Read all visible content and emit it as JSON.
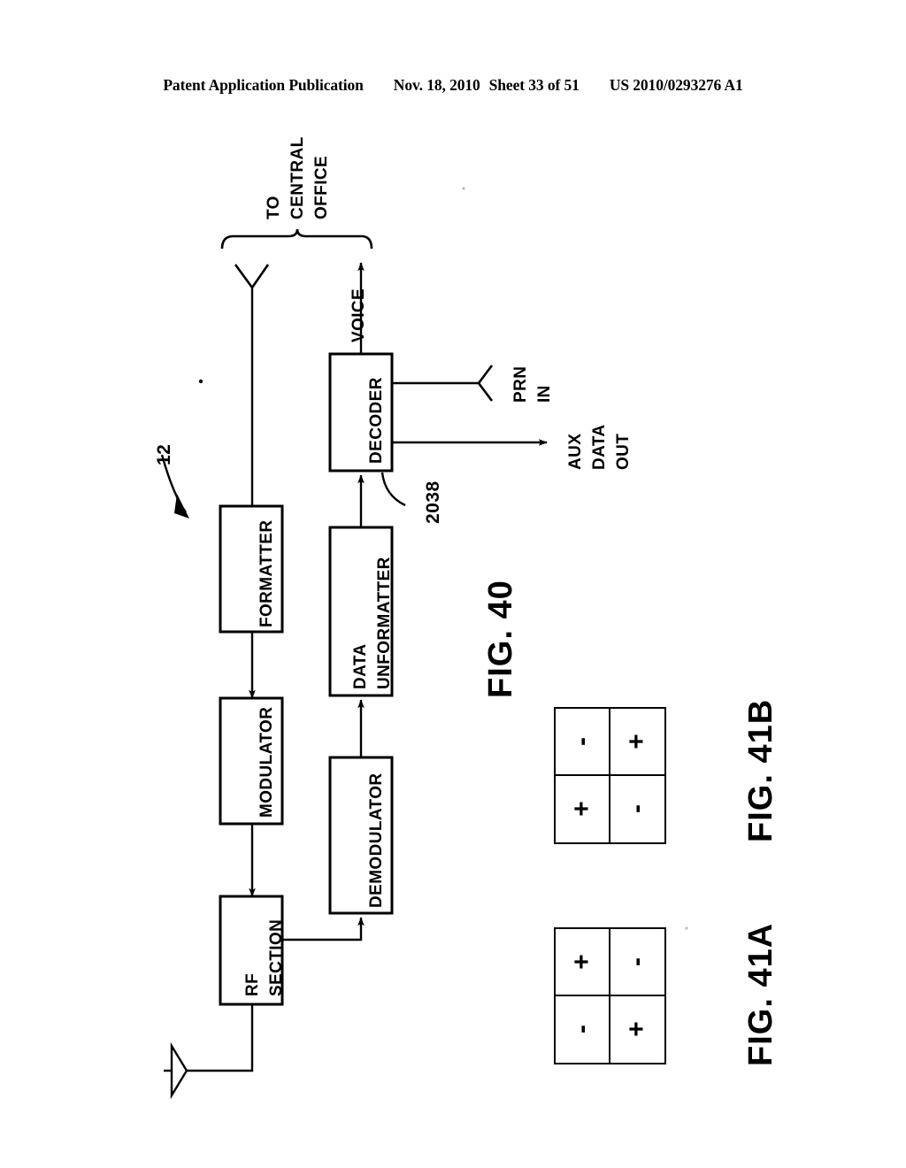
{
  "header": {
    "publication": "Patent Application Publication",
    "date": "Nov. 18, 2010",
    "sheet": "Sheet 33 of 51",
    "patent_number": "US 2010/0293276 A1"
  },
  "figures": {
    "fig40": {
      "label": "FIG. 40",
      "reference_numerals": {
        "system": "12",
        "decoder_lead": "2038"
      },
      "brace_label_lines": [
        "TO",
        "CENTRAL",
        "OFFICE"
      ],
      "blocks": [
        {
          "id": "formatter",
          "label": "FORMATTER"
        },
        {
          "id": "modulator",
          "label": "MODULATOR"
        },
        {
          "id": "rf-section",
          "label_line1": "RF",
          "label_line2": "SECTION"
        },
        {
          "id": "demodulator",
          "label": "DEMODULATOR"
        },
        {
          "id": "data-unformatter",
          "label_line1": "DATA",
          "label_line2": "UNFORMATTER"
        },
        {
          "id": "decoder",
          "label": "DECODER"
        }
      ],
      "signals": {
        "voice": "VOICE",
        "prn_in_line1": "PRN",
        "prn_in_line2": "IN",
        "aux_out_line1": "AUX",
        "aux_out_line2": "DATA",
        "aux_out_line3": "OUT"
      }
    },
    "fig41a": {
      "label": "FIG. 41A",
      "cells": [
        "+",
        "-",
        "-",
        "+"
      ]
    },
    "fig41b": {
      "label": "FIG. 41B",
      "cells": [
        "-",
        "+",
        "+",
        "-"
      ]
    }
  },
  "colors": {
    "ink": "#000000",
    "paper": "#ffffff"
  }
}
